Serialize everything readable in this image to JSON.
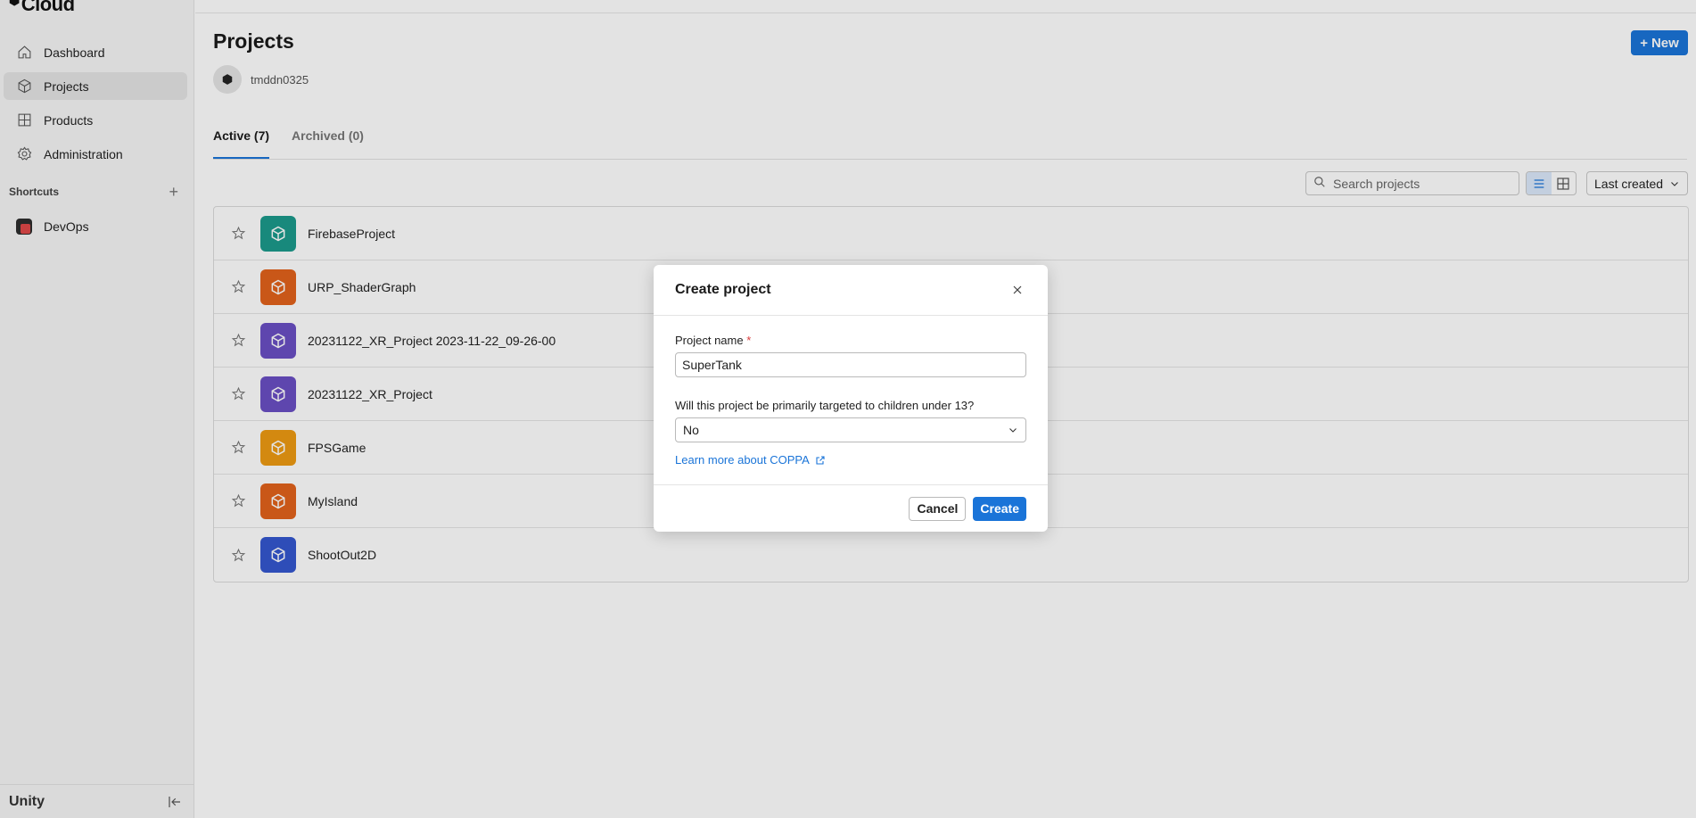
{
  "app": {
    "logo_text": "Cloud",
    "footer_brand": "Unity"
  },
  "sidebar": {
    "items": [
      {
        "label": "Dashboard",
        "icon": "home-icon"
      },
      {
        "label": "Projects",
        "icon": "cube-icon",
        "active": true
      },
      {
        "label": "Products",
        "icon": "grid-icon"
      },
      {
        "label": "Administration",
        "icon": "gear-icon"
      }
    ],
    "shortcuts_heading": "Shortcuts",
    "shortcuts": [
      {
        "label": "DevOps",
        "icon": "devops-icon"
      }
    ]
  },
  "header": {
    "title": "Projects",
    "new_button": "New",
    "org_name": "tmddn0325"
  },
  "tabs": [
    {
      "label": "Active (7)",
      "active": true
    },
    {
      "label": "Archived (0)",
      "active": false
    }
  ],
  "toolbar": {
    "search_placeholder": "Search projects",
    "sort_label": "Last created"
  },
  "projects": [
    {
      "name": "FirebaseProject",
      "color": "#1b9a8c"
    },
    {
      "name": "URP_ShaderGraph",
      "color": "#e2621b"
    },
    {
      "name": "20231122_XR_Project 2023-11-22_09-26-00",
      "color": "#6a4fc4"
    },
    {
      "name": "20231122_XR_Project",
      "color": "#6a4fc4"
    },
    {
      "name": "FPSGame",
      "color": "#ee9a12"
    },
    {
      "name": "MyIsland",
      "color": "#e2621b"
    },
    {
      "name": "ShootOut2D",
      "color": "#3457cf"
    }
  ],
  "dialog": {
    "title": "Create project",
    "project_name_label": "Project name",
    "required_mark": "*",
    "project_name_value": "SuperTank",
    "children_question": "Will this project be primarily targeted to children under 13?",
    "children_answer": "No",
    "learn_more": "Learn more about COPPA",
    "cancel": "Cancel",
    "create": "Create"
  },
  "colors": {
    "accent": "#1a74d8",
    "required": "#d83a3a"
  }
}
